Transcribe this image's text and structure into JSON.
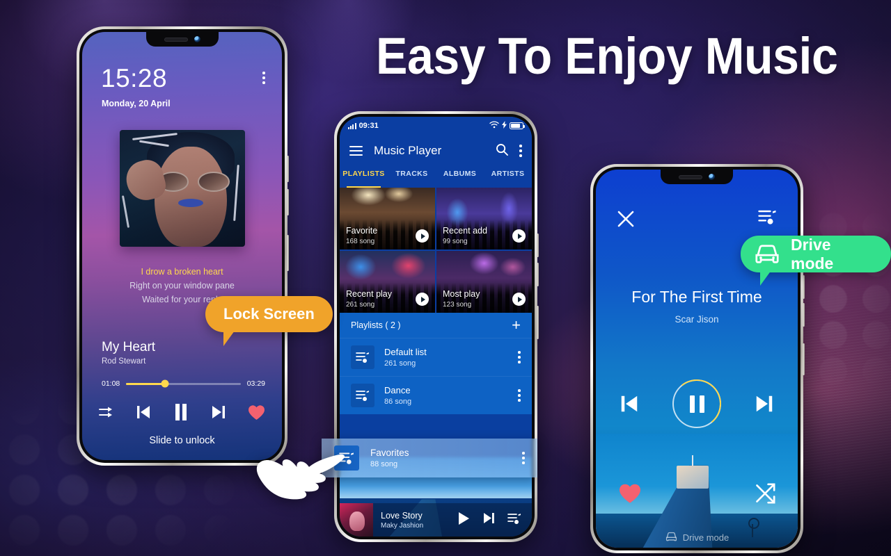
{
  "headline": "Easy To Enjoy Music",
  "badges": {
    "lock_screen": "Lock Screen",
    "drive_mode": "Drive mode",
    "car_icon": "car-icon"
  },
  "lock_screen": {
    "time": "15:28",
    "date": "Monday, 20 April",
    "menu_icon": "kebab-menu-icon",
    "album_art_alt": "woman-with-sunglasses-album-art",
    "lyrics": [
      "I drow a broken heart",
      "Right on your window pane",
      "Waited for your reply"
    ],
    "song_title": "My Heart",
    "artist": "Rod Stewart",
    "elapsed": "01:08",
    "duration": "03:29",
    "progress_percent": 34,
    "controls": [
      "shuffle-icon",
      "previous-icon",
      "pause-icon",
      "next-icon",
      "favorite-heart-icon"
    ],
    "unlock_hint": "Slide to unlock",
    "accent_color": "#ffd84d",
    "heart_color": "#f4616f"
  },
  "music_player": {
    "status_bar": {
      "time": "09:31",
      "signal_icon": "signal-bars-icon",
      "wifi_icon": "wifi-icon",
      "charging_icon": "charging-bolt-icon",
      "battery_icon": "battery-icon"
    },
    "app_bar": {
      "menu_icon": "hamburger-menu-icon",
      "title": "Music Player",
      "search_icon": "search-icon",
      "overflow_icon": "kebab-menu-icon"
    },
    "tabs": [
      {
        "label": "PLAYLISTS",
        "active": true
      },
      {
        "label": "TRACKS",
        "active": false
      },
      {
        "label": "ALBUMS",
        "active": false
      },
      {
        "label": "ARTISTS",
        "active": false
      }
    ],
    "tab_active_color": "#ffd84d",
    "tiles": [
      {
        "label": "Favorite",
        "count": "168 song",
        "play_icon": "play-circle-icon"
      },
      {
        "label": "Recent add",
        "count": "99 song",
        "play_icon": "play-circle-icon"
      },
      {
        "label": "Recent play",
        "count": "261 song",
        "play_icon": "play-circle-icon"
      },
      {
        "label": "Most play",
        "count": "123 song",
        "play_icon": "play-circle-icon"
      }
    ],
    "playlists_header": "Playlists ( 2 )",
    "add_icon": "plus-icon",
    "playlists": [
      {
        "name": "Default list",
        "count": "261 song",
        "icon": "playlist-music-icon",
        "overflow_icon": "kebab-menu-icon"
      },
      {
        "name": "Dance",
        "count": "86 song",
        "icon": "playlist-music-icon",
        "overflow_icon": "kebab-menu-icon"
      }
    ],
    "dragged_item": {
      "name": "Favorites",
      "count": "88 song",
      "icon": "playlist-music-icon",
      "overflow_icon": "kebab-menu-icon"
    },
    "mini_player": {
      "title": "Love Story",
      "artist": "Maky Jashion",
      "play_icon": "play-icon",
      "next_icon": "next-icon",
      "queue_icon": "playlist-queue-icon"
    }
  },
  "drive_mode": {
    "close_icon": "close-x-icon",
    "queue_icon": "playlist-queue-icon",
    "song_title": "For The First Time",
    "artist": "Scar Jison",
    "previous_icon": "previous-icon",
    "pause_icon": "pause-icon",
    "next_icon": "next-icon",
    "progress_color": "#ffd84d",
    "favorite_icon": "favorite-heart-icon",
    "shuffle_icon": "shuffle-icon",
    "footer_label": "Drive mode",
    "footer_icon": "car-icon"
  },
  "cursor": {
    "icon": "pointing-hand-cursor"
  },
  "colors": {
    "accent_yellow": "#ffd84d",
    "badge_orange": "#f0a32a",
    "badge_green": "#33e08c",
    "player_blue": "#0b3ea2",
    "heart_red": "#f4616f"
  }
}
